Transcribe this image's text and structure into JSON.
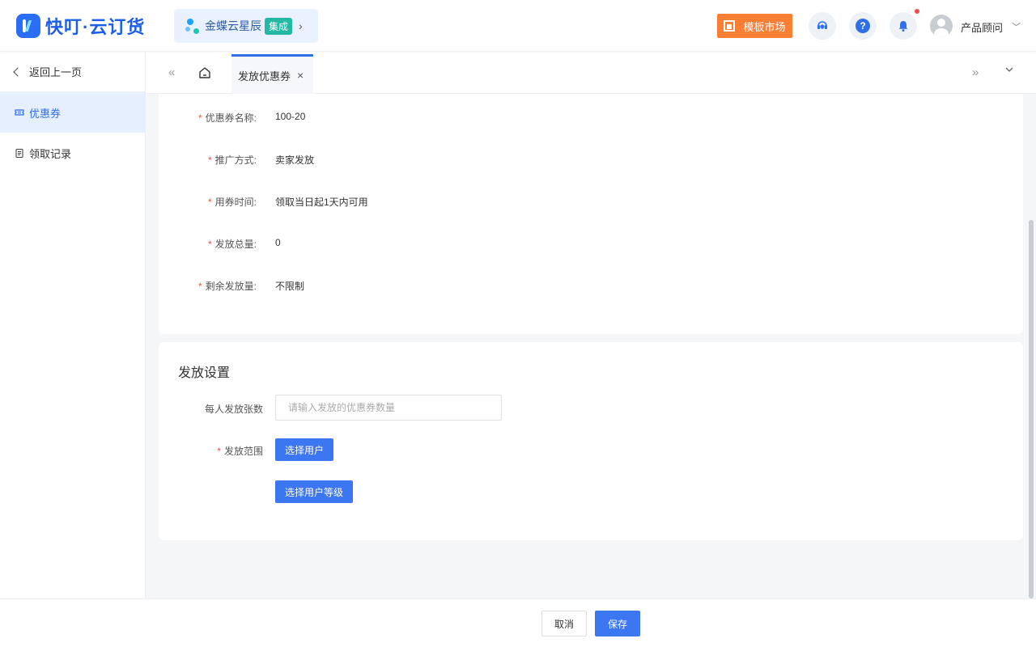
{
  "header": {
    "logo_text": "快叮·云订货",
    "brand": {
      "name": "金蝶云星辰",
      "badge": "集成"
    },
    "market_button": "模板市场",
    "user_name": "产品顾问",
    "notification_dot_color": "#f24d4d"
  },
  "sidebar": {
    "back_label": "返回上一页",
    "items": [
      {
        "label": "优惠券",
        "active": true
      },
      {
        "label": "领取记录",
        "active": false
      }
    ]
  },
  "tabs": [
    {
      "label": "发放优惠券",
      "active": true
    }
  ],
  "coupon_info": {
    "fields": [
      {
        "label": "优惠券名称:",
        "value": "100-20",
        "required": true
      },
      {
        "label": "推广方式:",
        "value": "卖家发放",
        "required": true
      },
      {
        "label": "用券时间:",
        "value": "领取当日起1天内可用",
        "required": true
      },
      {
        "label": "发放总量:",
        "value": "0",
        "required": true
      },
      {
        "label": "剩余发放量:",
        "value": "不限制",
        "required": true
      }
    ]
  },
  "distribution": {
    "title": "发放设置",
    "per_person_label": "每人发放张数",
    "per_person_value": "",
    "per_person_placeholder": "请输入发放的优惠券数量",
    "scope_label": "发放范围",
    "select_users_button": "选择用户",
    "select_levels_button": "选择用户等级"
  },
  "footer": {
    "cancel_label": "取消",
    "save_label": "保存"
  },
  "colors": {
    "primary": "#3d76f1",
    "accent_orange": "#fa7f35",
    "active_menu_bg": "#e6effe",
    "required_mark": "#f24d4d"
  }
}
